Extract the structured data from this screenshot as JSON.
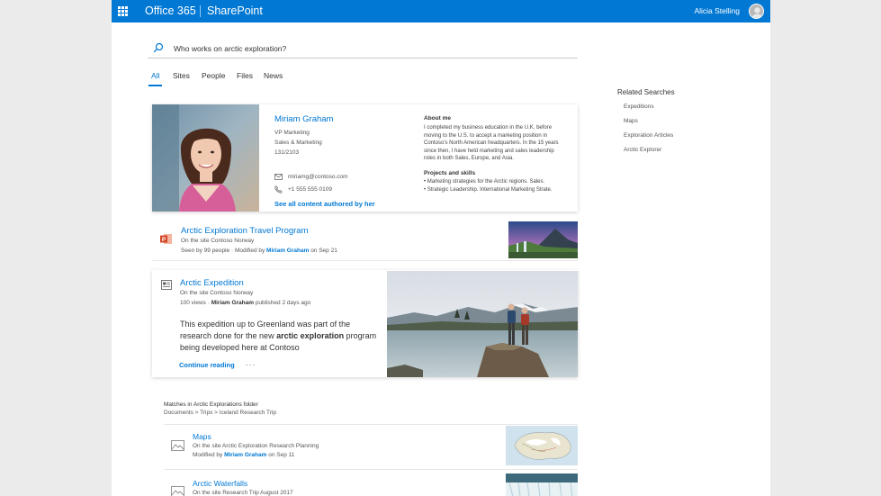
{
  "suite": {
    "brand": "Office 365",
    "app": "SharePoint",
    "user_name": "Alicia Stelling"
  },
  "search": {
    "query": "Who works on arctic exploration?"
  },
  "tabs": [
    {
      "label": "All",
      "active": true
    },
    {
      "label": "Sites",
      "active": false
    },
    {
      "label": "People",
      "active": false
    },
    {
      "label": "Files",
      "active": false
    },
    {
      "label": "News",
      "active": false
    }
  ],
  "related": {
    "title": "Related Searches",
    "items": [
      "Expeditions",
      "Maps",
      "Exploration Articles",
      "Arctic Explorer"
    ]
  },
  "person": {
    "name": "Miriam Graham",
    "title": "VP Marketing",
    "department": "Sales & Marketing",
    "office": "131/2103",
    "email": "miriamg@contoso.com",
    "phone": "+1 555 555 0109",
    "link": "See all content authored by her",
    "about_title": "About me",
    "about_lines": [
      "I completed my business education in the U.K. before",
      "moving to the U.S. to accept a marketing position in",
      "Contoso's North American headquarters. In the 15 years",
      "since then, I have held marketing and sales leadership",
      "roles in both Sales, Europe, and Asia."
    ],
    "skills_title": "Projects and skills",
    "skills": [
      "• Marketing strategies for the Arctic regions. Sales.",
      "• Strategic Leadership. International Marketing Strate."
    ]
  },
  "result1": {
    "title": "Arctic Exploration Travel Program",
    "site": "On the site Contoso Norway",
    "meta_prefix": "Seen by 99 people  ·  Modified by",
    "author": "Miriam Graham",
    "meta_suffix": "on Sep 21"
  },
  "news": {
    "title": "Arctic Expedition",
    "site": "On the site Contoso Norway",
    "meta_prefix": "100 views  ·",
    "author": "Miriam Graham",
    "meta_suffix": "published 2 days ago",
    "summary_prefix": "This expedition up to Greenland was part of the research done for the new",
    "summary_bold": "arctic exploration",
    "summary_suffix": "program being developed here at Contoso",
    "continue": "Continue reading",
    "more": "···"
  },
  "folder": {
    "title": "Matches in Arctic Explorations folder",
    "breadcrumb": "Documents  >  Trips  >  Iceland Research Trip"
  },
  "files": [
    {
      "title": "Maps",
      "site": "On the site Arctic Exploration Research Planning",
      "meta_prefix": "Modified by",
      "author": "Miriam Graham",
      "meta_suffix": "on Sep 11"
    },
    {
      "title": "Arctic Waterfalls",
      "site": "On the site Research Trip August 2017",
      "meta_prefix": "",
      "author": "",
      "meta_suffix": ""
    }
  ]
}
